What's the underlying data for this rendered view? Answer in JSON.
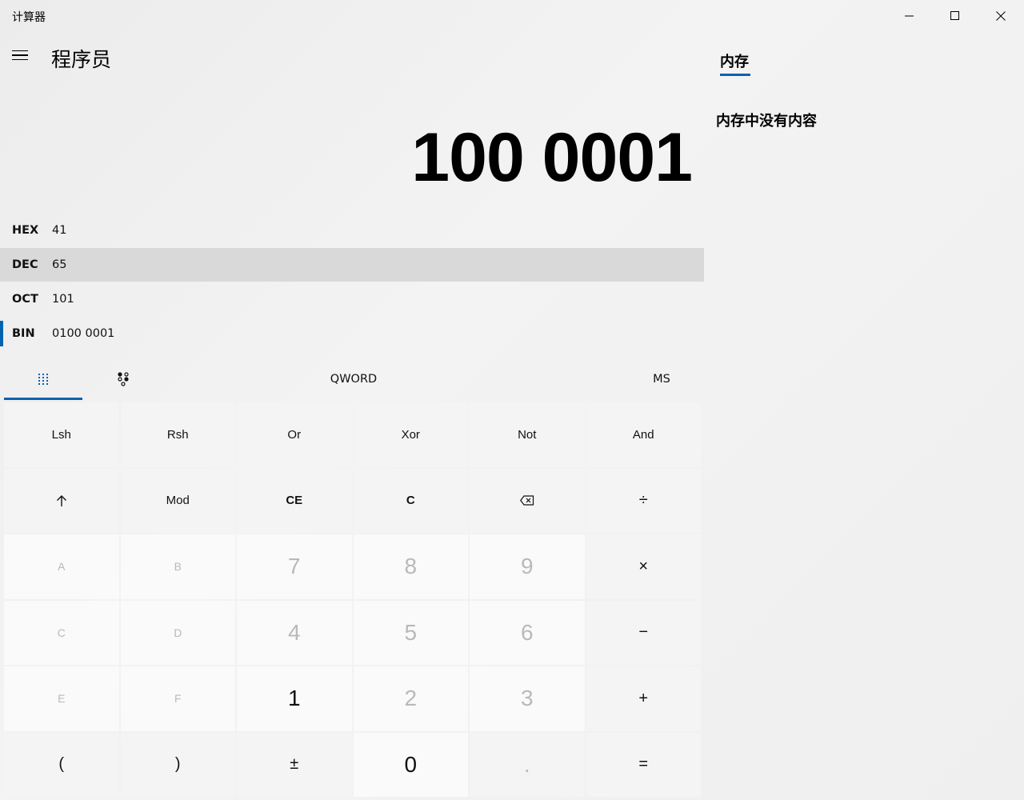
{
  "window": {
    "title": "计算器",
    "minimize_icon": "minimize-icon",
    "maximize_icon": "maximize-icon",
    "close_icon": "close-icon"
  },
  "header": {
    "menu_icon": "hamburger-menu-icon",
    "mode": "程序员"
  },
  "display": {
    "value": "100 0001"
  },
  "radix": [
    {
      "label": "HEX",
      "value": "41",
      "selected": false
    },
    {
      "label": "DEC",
      "value": "65",
      "selected": false,
      "hovered": true
    },
    {
      "label": "OCT",
      "value": "101",
      "selected": false
    },
    {
      "label": "BIN",
      "value": "0100 0001",
      "selected": true
    }
  ],
  "modebar": {
    "keypad_icon": "full-keypad-icon",
    "bits_icon": "bit-toggling-keypad-icon",
    "word_size": "QWORD",
    "memory_store": "MS"
  },
  "keys": {
    "row1": [
      "Lsh",
      "Rsh",
      "Or",
      "Xor",
      "Not",
      "And"
    ],
    "row2": [
      "↑",
      "Mod",
      "CE",
      "C",
      "⌫",
      "÷"
    ],
    "row3": [
      "A",
      "B",
      "7",
      "8",
      "9",
      "×"
    ],
    "row4": [
      "C",
      "D",
      "4",
      "5",
      "6",
      "−"
    ],
    "row5": [
      "E",
      "F",
      "1",
      "2",
      "3",
      "+"
    ],
    "row6": [
      "(",
      ")",
      "±",
      "0",
      ".",
      "="
    ]
  },
  "memory": {
    "tab_label": "内存",
    "empty_message": "内存中没有内容"
  },
  "colors": {
    "accent": "#0063b1",
    "hover_row": "#d9d9d9",
    "disabled_text": "#b9b9b9"
  }
}
